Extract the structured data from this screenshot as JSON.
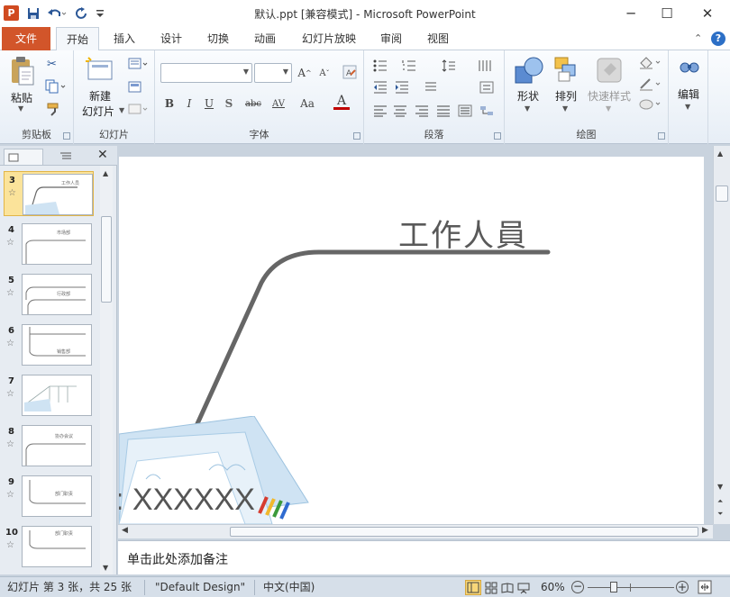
{
  "window": {
    "title": "默认.ppt [兼容模式] - Microsoft PowerPoint",
    "app_badge": "P",
    "quick_access": [
      "save-icon",
      "undo-icon",
      "redo-icon",
      "customize-icon"
    ]
  },
  "tabs": [
    {
      "label": "文件"
    },
    {
      "label": "开始"
    },
    {
      "label": "插入"
    },
    {
      "label": "设计"
    },
    {
      "label": "切换"
    },
    {
      "label": "动画"
    },
    {
      "label": "幻灯片放映"
    },
    {
      "label": "审阅"
    },
    {
      "label": "视图"
    }
  ],
  "ribbon": {
    "groups": {
      "clipboard": "剪贴板",
      "slides": "幻灯片",
      "font": "字体",
      "paragraph": "段落",
      "drawing": "绘图",
      "editing": ""
    },
    "paste_label": "粘贴",
    "new_slide_label_1": "新建",
    "new_slide_label_2": "幻灯片",
    "shapes_label": "形状",
    "arrange_label": "排列",
    "quick_styles_label": "快速样式",
    "edit_label": "编辑",
    "font_buttons": [
      "B",
      "I",
      "U",
      "S",
      "abc",
      "AV",
      "Aa",
      "A"
    ],
    "grow_font": "A",
    "shrink_font": "A"
  },
  "thumbnails": [
    {
      "num": "3",
      "star": "☆",
      "caption": "工作人员",
      "selected": true
    },
    {
      "num": "4",
      "star": "☆",
      "caption": "市场部",
      "selected": false
    },
    {
      "num": "5",
      "star": "☆",
      "caption": "行政部",
      "selected": false
    },
    {
      "num": "6",
      "star": "☆",
      "caption": "销售部",
      "selected": false
    },
    {
      "num": "7",
      "star": "☆",
      "caption": "",
      "selected": false
    },
    {
      "num": "8",
      "star": "☆",
      "caption": "协办会议",
      "selected": false
    },
    {
      "num": "9",
      "star": "☆",
      "caption": "部门职责",
      "selected": false
    },
    {
      "num": "10",
      "star": "☆",
      "caption": "部门职责",
      "selected": false
    }
  ],
  "slide": {
    "heading": "工作人員",
    "footer_text": ": XXXXXX"
  },
  "notes": {
    "placeholder": "单击此处添加备注"
  },
  "status": {
    "slide_info": "幻灯片 第 3 张，共 25 张",
    "theme": "\"Default Design\"",
    "language": "中文(中国)",
    "zoom": "60%",
    "zoom_fraction": 0.6
  },
  "colors": {
    "file_tab": "#d2552a",
    "selected_thumb": "#fbe39a",
    "ribbon_bg": "#e7eef6"
  }
}
